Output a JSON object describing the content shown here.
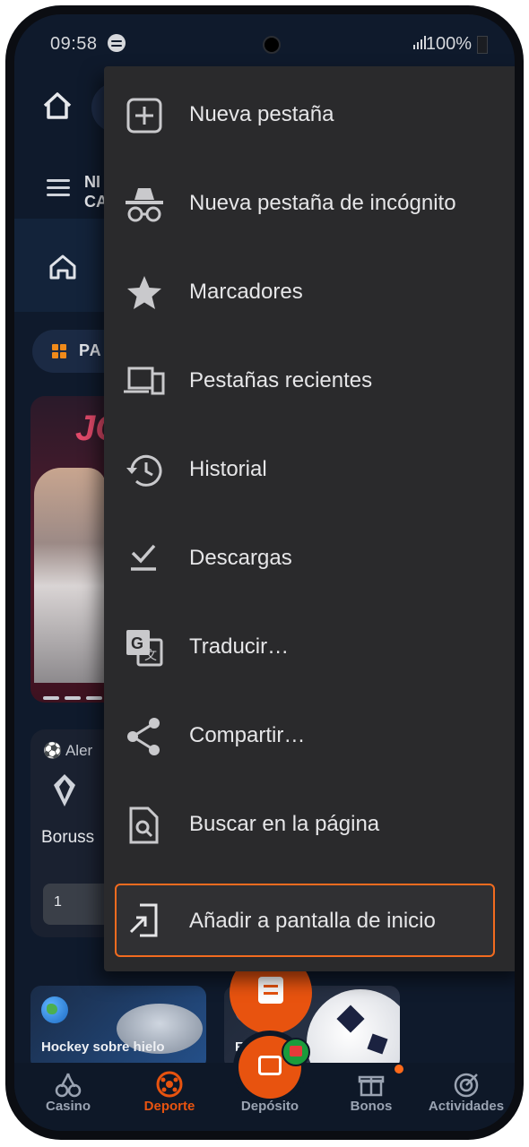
{
  "status_bar": {
    "time": "09:58",
    "battery": "100%",
    "icons": [
      "spotify-icon",
      "signal-icon",
      "battery-icon"
    ]
  },
  "page": {
    "header_text": "NI CA",
    "header_text_line1": "NI",
    "header_text_line2": "CA",
    "pills_label": "PA",
    "banner_title": "JO",
    "card": {
      "league": "Aler",
      "team": "Boruss",
      "odd": "1"
    },
    "tiles": [
      {
        "label": "Hockey sobre hielo"
      },
      {
        "label": "Fútb"
      }
    ]
  },
  "bottom_nav": {
    "items": [
      {
        "label": "Casino",
        "icon": "cherries-icon"
      },
      {
        "label": "Deporte",
        "icon": "soccer-ball-icon",
        "active": true
      },
      {
        "label": "Depósito",
        "icon": "wallet-icon"
      },
      {
        "label": "Bonos",
        "icon": "gift-icon"
      },
      {
        "label": "Actividades",
        "icon": "target-icon"
      }
    ]
  },
  "menu": {
    "items": [
      {
        "label": "Nueva pestaña",
        "icon": "new-tab-icon"
      },
      {
        "label": "Nueva pestaña de incógnito",
        "icon": "incognito-icon"
      },
      {
        "label": "Marcadores",
        "icon": "star-icon"
      },
      {
        "label": "Pestañas recientes",
        "icon": "devices-icon"
      },
      {
        "label": "Historial",
        "icon": "history-icon"
      },
      {
        "label": "Descargas",
        "icon": "download-icon"
      },
      {
        "label": "Traducir…",
        "icon": "translate-icon"
      },
      {
        "label": "Compartir…",
        "icon": "share-icon"
      },
      {
        "label": "Buscar en la página",
        "icon": "find-in-page-icon"
      },
      {
        "label": "Añadir a pantalla de inicio",
        "icon": "add-to-home-icon",
        "highlighted": true
      }
    ]
  },
  "colors": {
    "accent": "#e8530f",
    "highlight_border": "#f26b1f",
    "menu_bg": "#2a2a2c",
    "page_bg": "#0f1a2c"
  }
}
